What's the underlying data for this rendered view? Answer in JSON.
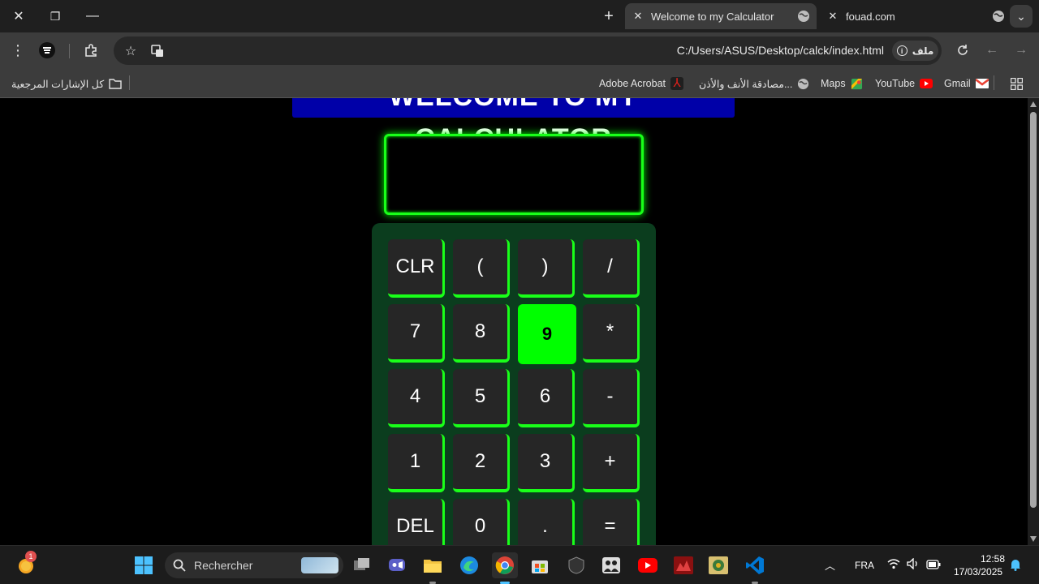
{
  "window": {
    "close_glyph": "✕",
    "restore_glyph": "❐",
    "minimize_glyph": "—",
    "new_tab_glyph": "+",
    "tab_menu_glyph": "⌄"
  },
  "tabs": [
    {
      "title": "Welcome to my Calculator",
      "active": true
    },
    {
      "title": "fouad.com",
      "active": false
    }
  ],
  "toolbar": {
    "url": "C:/Users/ASUS/Desktop/calck/index.html",
    "file_chip": "ملف",
    "menu_glyph": "⋮",
    "star_glyph": "☆"
  },
  "bookmarks": {
    "all_bookmarks": "كل الإشارات المرجعية",
    "items": [
      {
        "label": "Gmail",
        "icon": "gmail-icon"
      },
      {
        "label": "YouTube",
        "icon": "youtube-icon"
      },
      {
        "label": "Maps",
        "icon": "maps-icon"
      },
      {
        "label": "مصادقة الأنف والأذن...",
        "icon": "globe-icon"
      },
      {
        "label": "Adobe Acrobat",
        "icon": "acrobat-icon"
      }
    ]
  },
  "page": {
    "welcome_heading": "WELCOME TO MY CALCULATOR",
    "display_value": "",
    "keys": [
      [
        "CLR",
        "(",
        ")",
        "/"
      ],
      [
        "7",
        "8",
        "9",
        "*"
      ],
      [
        "4",
        "5",
        "6",
        "-"
      ],
      [
        "1",
        "2",
        "3",
        "+"
      ],
      [
        "DEL",
        "0",
        ".",
        "="
      ]
    ],
    "hovered_key": "9",
    "colors": {
      "accent": "#00ff00",
      "pad_bg": "#0b3d1e",
      "heading_bg": "#0000a8"
    }
  },
  "taskbar": {
    "search_placeholder": "Rechercher",
    "notification_count": "1",
    "language": "FRA",
    "time": "12:58",
    "date": "17/03/2025"
  }
}
